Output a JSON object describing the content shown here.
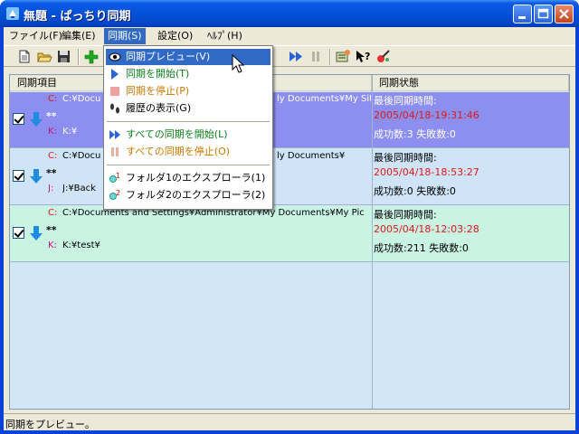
{
  "window": {
    "title": "無題 - ぱっちり同期",
    "app_icon": "sync-app-icon"
  },
  "menubar": {
    "items": [
      {
        "label": "ファイル(F)"
      },
      {
        "label": "編集(E)"
      },
      {
        "label": "同期(S)"
      },
      {
        "label": "設定(O)"
      },
      {
        "label": "ﾍﾙﾌﾟ(H)"
      }
    ]
  },
  "toolbar": {
    "icons": [
      "new-file-icon",
      "open-folder-icon",
      "save-icon",
      "add-icon",
      "sync-all-icon",
      "pause-icon",
      "settings-icon",
      "help-icon",
      "tools-icon"
    ]
  },
  "list": {
    "headers": [
      "同期項目",
      "同期状態"
    ],
    "rows": [
      {
        "src_label": "C:",
        "src_path": "C:¥Docu",
        "src_path_tail": "ly Documents¥My Site",
        "name": "**",
        "dst_label": "K:",
        "dst_path": "K:¥",
        "status_title": "最後同期時間:",
        "status_time": "2005/04/18-19:31:46",
        "status_counts": "成功数:3 失敗数:0"
      },
      {
        "src_label": "C:",
        "src_path": "C:¥Docu",
        "src_path_tail": "ly Documents¥",
        "name": "**",
        "dst_label": "J:",
        "dst_path": "J:¥Back",
        "status_title": "最後同期時間:",
        "status_time": "2005/04/18-18:53:27",
        "status_counts": "成功数:0 失敗数:0"
      },
      {
        "src_label": "C:",
        "src_path": "C:¥Documents and Settings¥Administrator¥My Documents¥My Pic",
        "src_path_tail": "",
        "name": "**",
        "dst_label": "K:",
        "dst_path": "K:¥test¥",
        "status_title": "最後同期時間:",
        "status_time": "2005/04/18-12:03:28",
        "status_counts": "成功数:211 失敗数:0"
      }
    ]
  },
  "dropdown": {
    "items": [
      {
        "label": "同期プレビュー(V)",
        "icon": "eye-icon"
      },
      {
        "label": "同期を開始(T)",
        "icon": "play-icon"
      },
      {
        "label": "同期を停止(P)",
        "icon": "stop-icon"
      },
      {
        "label": "履歴の表示(G)",
        "icon": "footprints-icon"
      },
      {
        "label": "すべての同期を開始(L)",
        "icon": "fast-forward-icon"
      },
      {
        "label": "すべての同期を停止(O)",
        "icon": "pause-icon"
      },
      {
        "label": "フォルダ1のエクスプローラ(1)",
        "icon": "folder1-search-icon"
      },
      {
        "label": "フォルダ2のエクスプローラ(2)",
        "icon": "folder2-search-icon"
      }
    ]
  },
  "statusbar": {
    "text": "同期をプレビュー。"
  },
  "colors": {
    "title_blue": "#0351d8",
    "selected_row": "#8c8ef0",
    "menu_highlight": "#316ac5",
    "time_red": "#e01818"
  }
}
